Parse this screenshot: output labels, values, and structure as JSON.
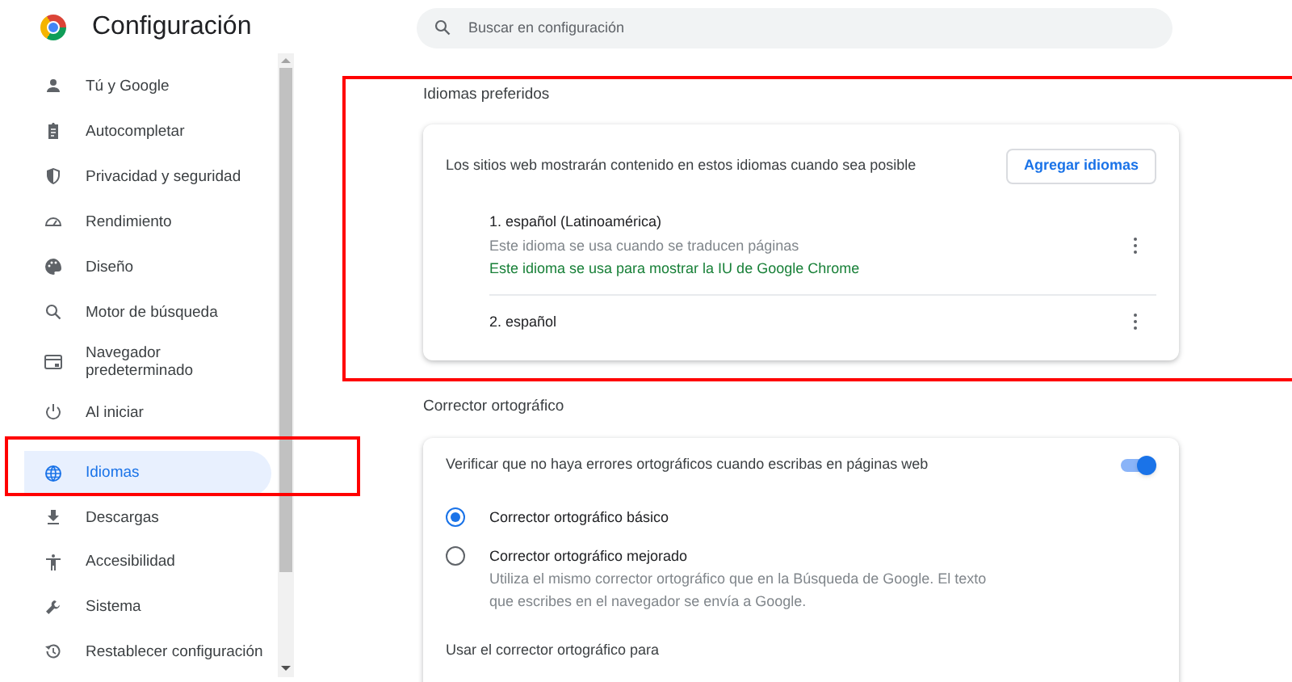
{
  "header": {
    "title": "Configuración"
  },
  "search": {
    "placeholder": "Buscar en configuración"
  },
  "sidebar": {
    "items": [
      {
        "label": "Tú y Google",
        "selected": false
      },
      {
        "label": "Autocompletar",
        "selected": false
      },
      {
        "label": "Privacidad y seguridad",
        "selected": false
      },
      {
        "label": "Rendimiento",
        "selected": false
      },
      {
        "label": "Diseño",
        "selected": false
      },
      {
        "label": "Motor de búsqueda",
        "selected": false
      },
      {
        "label": "Navegador predeterminado",
        "selected": false
      },
      {
        "label": "Al iniciar",
        "selected": false
      },
      {
        "label": "Idiomas",
        "selected": true
      },
      {
        "label": "Descargas",
        "selected": false
      },
      {
        "label": "Accesibilidad",
        "selected": false
      },
      {
        "label": "Sistema",
        "selected": false
      },
      {
        "label": "Restablecer configuración",
        "selected": false
      }
    ]
  },
  "languages": {
    "title": "Idiomas preferidos",
    "description": "Los sitios web mostrarán contenido en estos idiomas cuando sea posible",
    "add_button": "Agregar idiomas",
    "items": [
      {
        "name": "1. español (Latinoamérica)",
        "notes": [
          {
            "kind": "info",
            "text": "Este idioma se usa cuando se traducen páginas"
          },
          {
            "kind": "ui",
            "text": "Este idioma se usa para mostrar la IU de Google Chrome"
          }
        ]
      },
      {
        "name": "2. español"
      }
    ]
  },
  "spellcheck": {
    "title": "Corrector ortográfico",
    "toggle": {
      "label": "Verificar que no haya errores ortográficos cuando escribas en páginas web",
      "on": true
    },
    "options": [
      {
        "label": "Corrector ortográfico básico",
        "selected": true
      },
      {
        "label": "Corrector ortográfico mejorado",
        "description": "Utiliza el mismo corrector ortográfico que en la Búsqueda de Google. El texto que escribes en el navegador se envía a Google.",
        "selected": false
      }
    ],
    "footer": "Usar el corrector ortográfico para"
  }
}
